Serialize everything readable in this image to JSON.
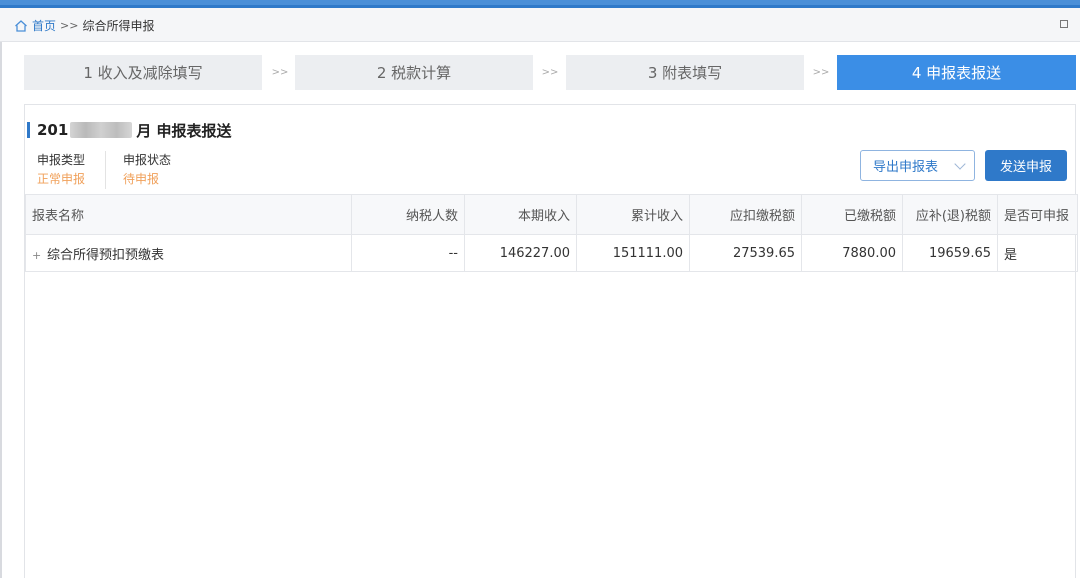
{
  "breadcrumb": {
    "home": "首页",
    "separator": ">>",
    "current": "综合所得申报"
  },
  "steps": [
    {
      "label": "1 收入及减除填写",
      "active": false
    },
    {
      "label": "2 税款计算",
      "active": false
    },
    {
      "label": "3 附表填写",
      "active": false
    },
    {
      "label": "4 申报表报送",
      "active": true
    }
  ],
  "step_separator": ">>",
  "panel": {
    "title_year": "201",
    "title_rest": "月  申报表报送",
    "declare_type_label": "申报类型",
    "declare_type_value": "正常申报",
    "declare_status_label": "申报状态",
    "declare_status_value": "待申报",
    "export_button": "导出申报表",
    "send_button": "发送申报"
  },
  "table": {
    "headers": [
      "报表名称",
      "纳税人数",
      "本期收入",
      "累计收入",
      "应扣缴税额",
      "已缴税额",
      "应补(退)税额",
      "是否可申报"
    ],
    "rows": [
      {
        "expand": "+",
        "name": "综合所得预扣预缴表",
        "taxpayers": "--",
        "current_income": "146227.00",
        "cumulative_income": "151111.00",
        "tax_withheld_due": "27539.65",
        "tax_paid": "7880.00",
        "tax_balance": "19659.65",
        "can_declare": "是"
      }
    ]
  },
  "colors": {
    "accent": "#2f79c9",
    "active_step": "#3b8ee6",
    "status_orange": "#f0a05a",
    "yes_green": "#3bb34a"
  }
}
